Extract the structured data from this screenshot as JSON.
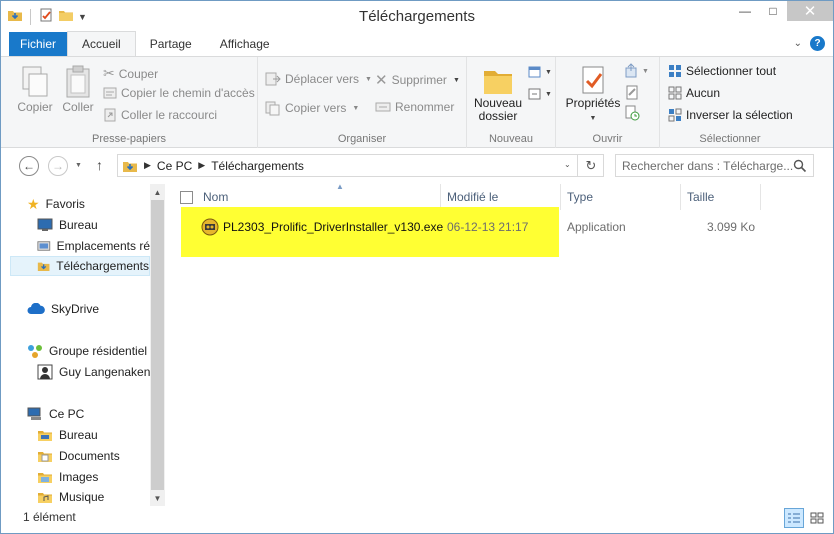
{
  "window": {
    "title": "Téléchargements"
  },
  "tabs": [
    {
      "label": "Fichier"
    },
    {
      "label": "Accueil"
    },
    {
      "label": "Partage"
    },
    {
      "label": "Affichage"
    }
  ],
  "ribbon": {
    "clipboard": {
      "label": "Presse-papiers",
      "copy": "Copier",
      "paste": "Coller",
      "cut": "Couper",
      "copy_path": "Copier le chemin d'accès",
      "paste_shortcut": "Coller le raccourci"
    },
    "organize": {
      "label": "Organiser",
      "move_to": "Déplacer vers",
      "copy_to": "Copier vers",
      "delete": "Supprimer",
      "rename": "Renommer"
    },
    "new": {
      "label": "Nouveau",
      "new_folder_line1": "Nouveau",
      "new_folder_line2": "dossier"
    },
    "open": {
      "label": "Ouvrir",
      "properties": "Propriétés"
    },
    "select": {
      "label": "Sélectionner",
      "select_all": "Sélectionner tout",
      "select_none": "Aucun",
      "invert": "Inverser la sélection"
    }
  },
  "address": {
    "breadcrumb": [
      "Ce PC",
      "Téléchargements"
    ],
    "search_placeholder": "Rechercher dans : Télécharge..."
  },
  "nav": {
    "favorites": "Favoris",
    "desktop": "Bureau",
    "recent": "Emplacements ré",
    "downloads": "Téléchargements",
    "skydrive": "SkyDrive",
    "homegroup": "Groupe résidentiel",
    "user": "Guy Langenaken",
    "this_pc": "Ce PC",
    "pc_desktop": "Bureau",
    "documents": "Documents",
    "images": "Images",
    "music": "Musique"
  },
  "columns": {
    "name": "Nom",
    "modified": "Modifié le",
    "type": "Type",
    "size": "Taille"
  },
  "files": [
    {
      "name": "PL2303_Prolific_DriverInstaller_v130.exe",
      "modified": "06-12-13 21:17",
      "type": "Application",
      "size": "3.099 Ko"
    }
  ],
  "status": {
    "count": "1 élément"
  },
  "colors": {
    "accent": "#1979ca",
    "highlight": "#ffff33",
    "ribbon_bg": "#f5f6f7"
  }
}
